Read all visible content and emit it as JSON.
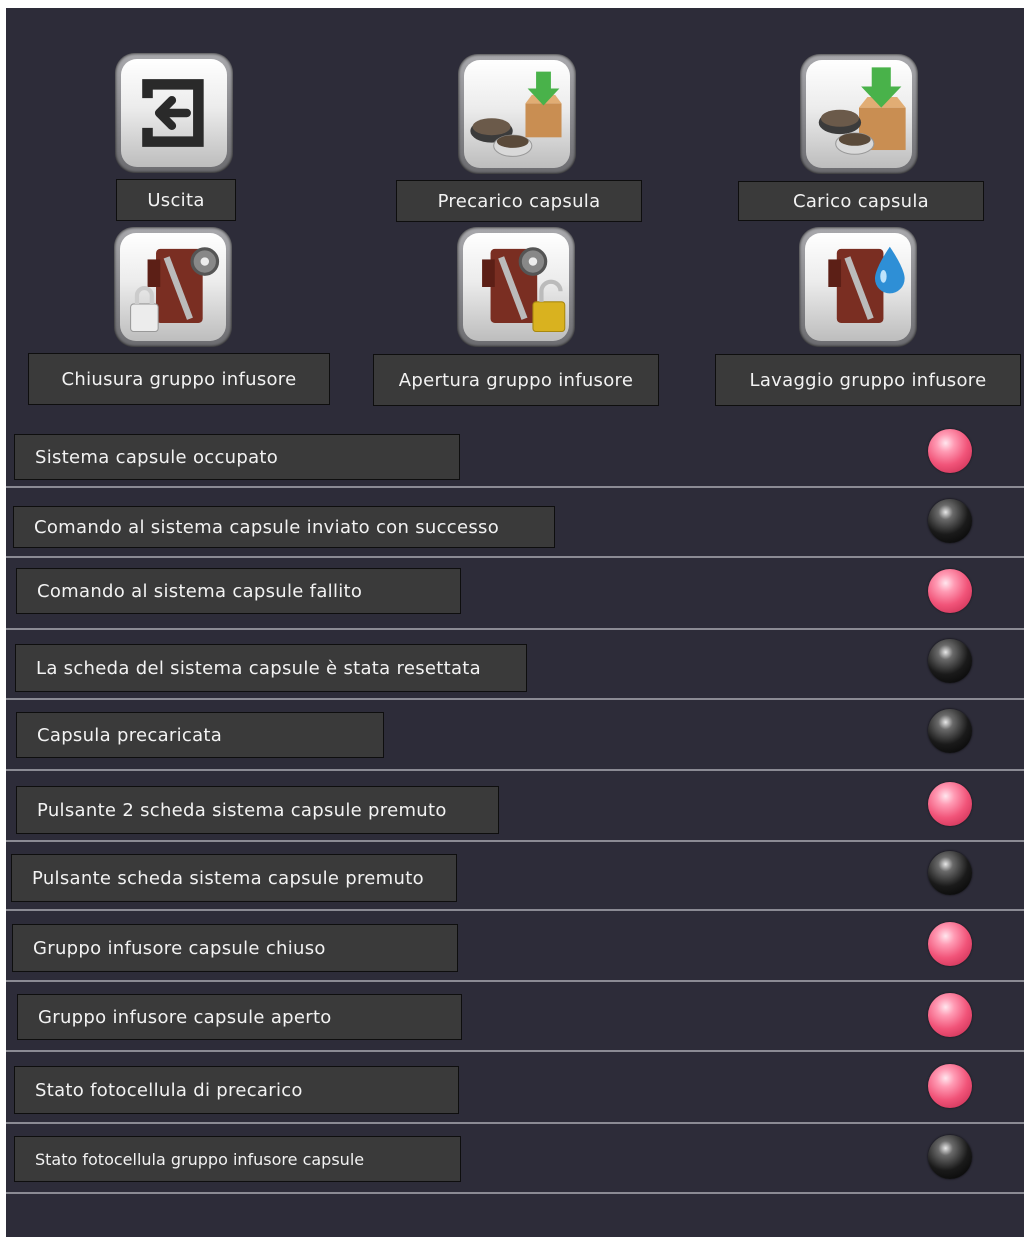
{
  "actions": [
    {
      "label": "Uscita",
      "icon": "exit-icon"
    },
    {
      "label": "Precarico capsula",
      "icon": "capsule-preload-icon"
    },
    {
      "label": "Carico capsula",
      "icon": "capsule-load-icon"
    },
    {
      "label": "Chiusura gruppo infusore",
      "icon": "brew-group-close-icon"
    },
    {
      "label": "Apertura gruppo infusore",
      "icon": "brew-group-open-icon"
    },
    {
      "label": "Lavaggio gruppo infusore",
      "icon": "brew-group-wash-icon"
    }
  ],
  "status": [
    {
      "label": "Sistema capsule occupato",
      "led": "on"
    },
    {
      "label": "Comando al sistema capsule inviato con successo",
      "led": "off"
    },
    {
      "label": "Comando al sistema capsule fallito",
      "led": "on"
    },
    {
      "label": "La scheda del sistema capsule è stata resettata",
      "led": "off"
    },
    {
      "label": "Capsula precaricata",
      "led": "off"
    },
    {
      "label": "Pulsante 2 scheda sistema capsule premuto",
      "led": "on"
    },
    {
      "label": "Pulsante scheda sistema capsule premuto",
      "led": "off"
    },
    {
      "label": "Gruppo infusore capsule chiuso",
      "led": "on"
    },
    {
      "label": "Gruppo infusore capsule aperto",
      "led": "on"
    },
    {
      "label": "Stato fotocellula di precarico",
      "led": "on"
    },
    {
      "label": "Stato fotocellula gruppo infusore capsule",
      "led": "off"
    }
  ],
  "colors": {
    "background": "#2d2c39",
    "label_box": "#3a3a3a",
    "led_on": "#f15479",
    "led_off": "#1a1a1a",
    "divider": "#8b8b94"
  }
}
